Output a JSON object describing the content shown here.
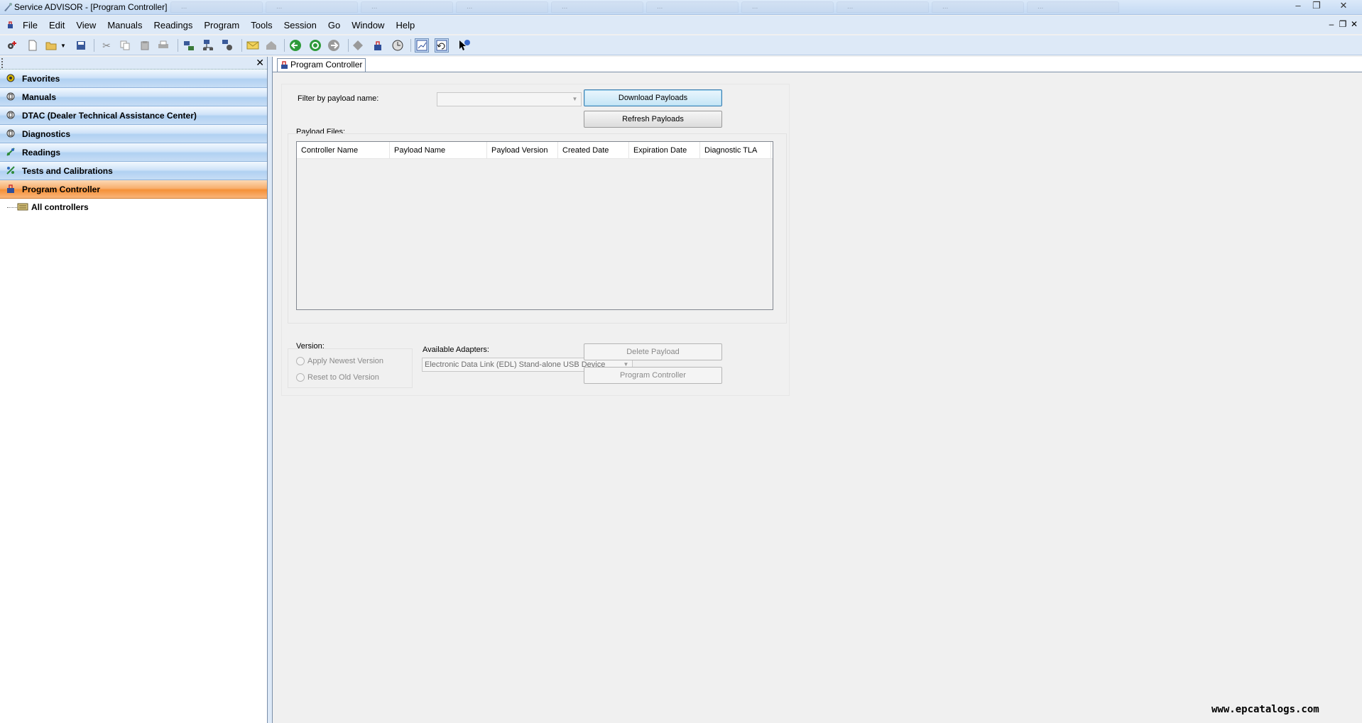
{
  "window": {
    "title": "Service ADVISOR - [Program Controller]",
    "background_tabs": [
      "...",
      "...",
      "...",
      "...",
      "...",
      "...",
      "...",
      "...",
      "...",
      "..."
    ]
  },
  "menu": {
    "items": [
      "File",
      "Edit",
      "View",
      "Manuals",
      "Readings",
      "Program",
      "Tools",
      "Session",
      "Go",
      "Window",
      "Help"
    ]
  },
  "toolbar": {
    "icons": [
      "settings-plus-icon",
      "new-document-icon",
      "open-folder-icon",
      "dropdown-arrow-icon",
      "save-icon",
      "cut-icon",
      "copy-icon",
      "paste-icon",
      "print-icon",
      "connect-icon",
      "network-icon",
      "network-config-icon",
      "message-icon",
      "home-icon",
      "back-icon",
      "refresh-icon",
      "forward-icon",
      "diamond-icon",
      "program-icon",
      "gear-clock-icon",
      "graph-icon",
      "undo-icon",
      "help-pointer-icon"
    ]
  },
  "sidebar": {
    "close_label": "✕",
    "items": [
      {
        "label": "Favorites",
        "icon": "favorites-gear-icon",
        "selected": false
      },
      {
        "label": "Manuals",
        "icon": "manuals-icon",
        "selected": false
      },
      {
        "label": "DTAC (Dealer Technical Assistance Center)",
        "icon": "dtac-icon",
        "selected": false
      },
      {
        "label": "Diagnostics",
        "icon": "diagnostics-icon",
        "selected": false
      },
      {
        "label": "Readings",
        "icon": "readings-icon",
        "selected": false
      },
      {
        "label": "Tests and Calibrations",
        "icon": "tests-icon",
        "selected": false
      },
      {
        "label": "Program Controller",
        "icon": "program-controller-icon",
        "selected": true
      }
    ],
    "tree": {
      "root_label": "All controllers"
    }
  },
  "document": {
    "tab_label": "Program Controller",
    "filter": {
      "label": "Filter by payload name:",
      "value": ""
    },
    "buttons": {
      "download": "Download Payloads",
      "refresh": "Refresh Payloads",
      "delete": "Delete Payload",
      "program": "Program Controller"
    },
    "payload_files": {
      "label": "Payload Files:",
      "columns": [
        "Controller Name",
        "Payload Name",
        "Payload Version",
        "Created Date",
        "Expiration Date",
        "Diagnostic TLA"
      ],
      "rows": []
    },
    "version": {
      "label": "Version:",
      "options": [
        "Apply Newest Version",
        "Reset to Old Version"
      ]
    },
    "adapters": {
      "label": "Available Adapters:",
      "selected": "Electronic Data Link (EDL) Stand-alone USB Device"
    }
  },
  "watermark": "www.epcatalogs.com",
  "colors": {
    "selected_nav": "#f59138",
    "nav_blue": "#b1d1f2",
    "chrome": "#dde9f7"
  }
}
